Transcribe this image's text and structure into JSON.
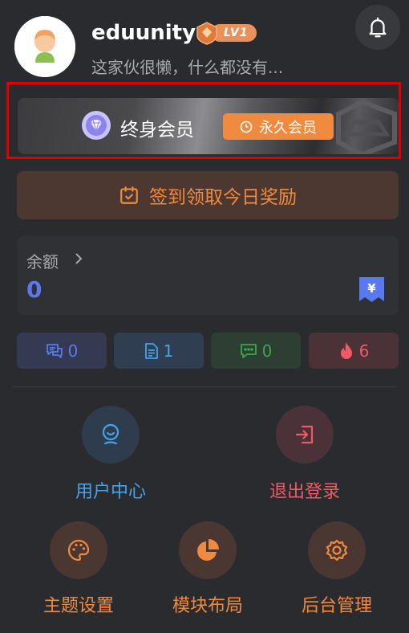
{
  "profile": {
    "username": "eduunity",
    "level": "LV1",
    "bio": "这家伙很懒，什么都没有..."
  },
  "vip": {
    "title": "终身会员",
    "tag": "永久会员"
  },
  "checkin": {
    "label": "签到领取今日奖励"
  },
  "balance": {
    "label": "余额",
    "value": "0"
  },
  "stats": [
    {
      "icon": "comments-icon",
      "value": "0"
    },
    {
      "icon": "document-icon",
      "value": "1"
    },
    {
      "icon": "message-icon",
      "value": "0"
    },
    {
      "icon": "fire-icon",
      "value": "6"
    }
  ],
  "actions": [
    {
      "label": "用户中心",
      "icon": "user-icon"
    },
    {
      "label": "退出登录",
      "icon": "logout-icon"
    },
    {
      "label": "主题设置",
      "icon": "palette-icon"
    },
    {
      "label": "模块布局",
      "icon": "pie-chart-icon"
    },
    {
      "label": "后台管理",
      "icon": "gear-icon"
    }
  ],
  "colors": {
    "background": "#2a2b2f",
    "accent_orange": "#f08a3e",
    "blue": "#45a3ee",
    "indigo": "#5a78f0",
    "green": "#3aa649",
    "red": "#ef5a64",
    "highlight_border": "#e00000"
  }
}
